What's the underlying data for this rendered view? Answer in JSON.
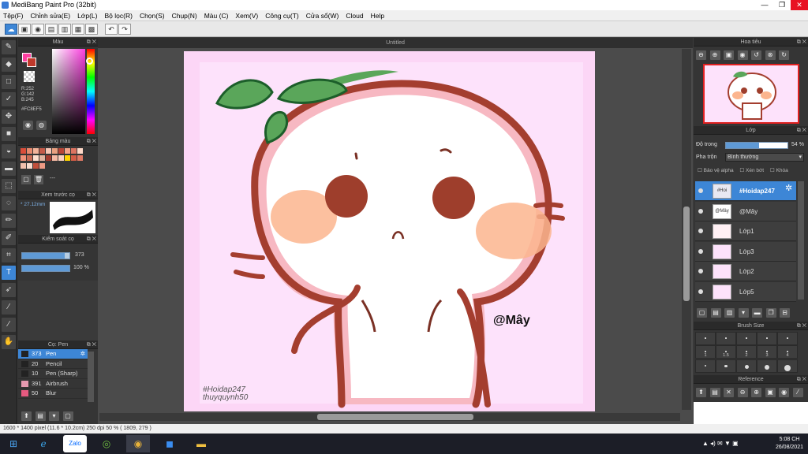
{
  "window": {
    "title": "MediBang Paint Pro (32bit)",
    "minimize": "—",
    "maximize": "❐",
    "close": "✕"
  },
  "menu": [
    "Tệp(F)",
    "Chỉnh sửa(E)",
    "Lớp(L)",
    "Bộ lọc(R)",
    "Chọn(S)",
    "Chụp(N)",
    "Màu (C)",
    "Xem(V)",
    "Công cụ(T)",
    "Cửa sổ(W)",
    "Cloud",
    "Help"
  ],
  "toolbar": {
    "undo_icon": "undo-icon",
    "redo_icon": "redo-icon"
  },
  "tools": [
    "brush-icon",
    "eraser-icon",
    "select-rect-icon",
    "lasso-icon",
    "move-icon",
    "fill-rect-icon",
    "bucket-icon",
    "gradient-icon",
    "dotted-select-icon",
    "magic-wand-icon",
    "select-pen-icon",
    "select-eraser-icon",
    "crop-icon",
    "text-icon",
    "operation-icon",
    "eyedropper-icon",
    "dropper-icon",
    "hand-icon"
  ],
  "color_panel": {
    "title": "Màu",
    "r": "R:252",
    "g": "G:142",
    "b": "B:245",
    "hex": "#FC8EF5",
    "primary": "#fc3fa0",
    "secondary": "#c0392b"
  },
  "swatch_panel": {
    "title": "Bảng màu",
    "dash": "---",
    "colors": [
      "#d94d3a",
      "#e88a6e",
      "#f2b39a",
      "#c45a48",
      "#f7c6b5",
      "#e9a080",
      "#b84536",
      "#f4a38a",
      "#dc7360",
      "#ffd9c8",
      "#f0927a",
      "#c96b55",
      "#ffe0d0",
      "#e3b4a0",
      "#a33a2e",
      "#f6baa5",
      "#fbd1bf",
      "#ffd400",
      "#d45c46",
      "#e07a65",
      "#f1c0ad",
      "#f8dccf",
      "#c14f3b",
      "#ee9a84"
    ]
  },
  "preview_panel": {
    "title": "Xem trước cọ",
    "size": "27.12mm"
  },
  "control_panel": {
    "title": "Kiểm soát cọ",
    "size_value": "373",
    "opacity_value": "100 %",
    "size_fraction": 0.9,
    "opacity_fraction": 1.0
  },
  "brush_panel": {
    "title": "Cọ: Pen",
    "items": [
      {
        "size": "373",
        "name": "Pen",
        "color": "#222222",
        "selected": true
      },
      {
        "size": "20",
        "name": "Pencil",
        "color": "#222222",
        "selected": false
      },
      {
        "size": "10",
        "name": "Pen (Sharp)",
        "color": "#222222",
        "selected": false
      },
      {
        "size": "391",
        "name": "Airbrush",
        "color": "#e59ab0",
        "selected": false
      },
      {
        "size": "50",
        "name": "Blur",
        "color": "#e65a80",
        "selected": false
      }
    ]
  },
  "doc": {
    "tab": "Untitled",
    "signature_tag": "#Hoidap247",
    "signature_name": "thuyquynh50",
    "watermark": "@Mây"
  },
  "navigator": {
    "title": "Hoa tiêu"
  },
  "layer_panel": {
    "title": "Lớp",
    "opacity_label": "Độ trong",
    "opacity_value": "54 %",
    "opacity_fraction": 0.54,
    "blend_label": "Pha trộn",
    "blend_value": "Bình thường",
    "protect_alpha": "Bảo vệ alpha",
    "clipping": "Xén bớt",
    "lock": "Khóa",
    "layers": [
      {
        "name": "#Hoidap247",
        "thumb": "#Hoi",
        "selected": true
      },
      {
        "name": "@Mây",
        "thumb": "@Mây",
        "selected": false
      },
      {
        "name": "Lớp1",
        "thumb": "",
        "selected": false
      },
      {
        "name": "Lớp3",
        "thumb": "",
        "selected": false
      },
      {
        "name": "Lớp2",
        "thumb": "",
        "selected": false
      },
      {
        "name": "Lớp5",
        "thumb": "",
        "selected": false
      }
    ]
  },
  "brush_size_panel": {
    "title": "Brush Size",
    "labels": [
      "1",
      "1.5",
      "2",
      "3",
      "4"
    ]
  },
  "reference_panel": {
    "title": "Reference"
  },
  "status": {
    "text": "1600 * 1400 pixel  (11.6 * 10.2cm)  250 dpi  50 %  ( 1809, 279 )"
  },
  "taskbar": {
    "time": "5:08 CH",
    "date": "26/08/2021",
    "apps": [
      "start-icon",
      "edge-icon",
      "zalo-icon",
      "antivirus-icon",
      "chrome-icon",
      "zoom-icon",
      "explorer-icon"
    ]
  }
}
